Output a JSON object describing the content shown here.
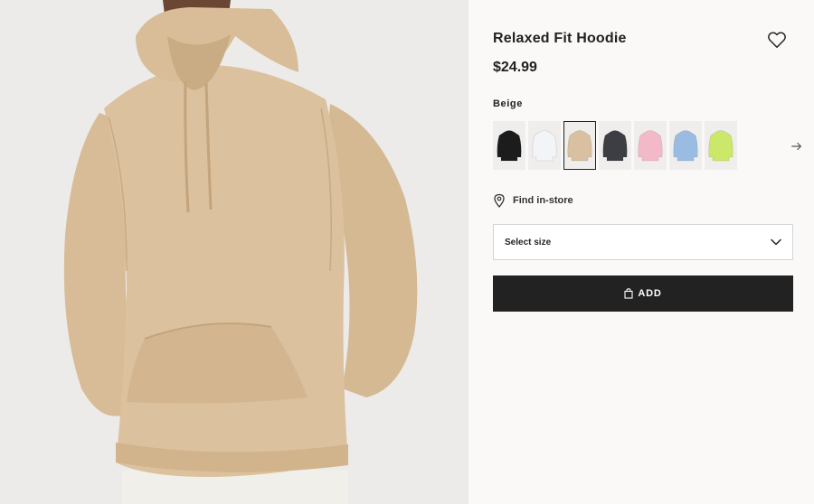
{
  "product": {
    "title": "Relaxed Fit Hoodie",
    "price": "$24.99",
    "selected_color": "Beige"
  },
  "swatches": [
    {
      "color": "#1c1c1c",
      "name": "black"
    },
    {
      "color": "#f2f4f7",
      "name": "white"
    },
    {
      "color": "#d9c0a0",
      "name": "beige"
    },
    {
      "color": "#3c3e44",
      "name": "dark-grey"
    },
    {
      "color": "#f3b9c8",
      "name": "pink"
    },
    {
      "color": "#9bbce2",
      "name": "light-blue"
    },
    {
      "color": "#cbe86a",
      "name": "lime"
    }
  ],
  "selected_swatch_index": 2,
  "store": {
    "find_label": "Find in-store"
  },
  "size": {
    "placeholder": "Select size"
  },
  "cart": {
    "add_label": "ADD"
  },
  "icons": {
    "favorite": "heart-icon",
    "next": "arrow-right-icon",
    "store": "location-pin-icon",
    "dropdown": "chevron-down-icon",
    "cart": "shopping-bag-icon"
  },
  "colors": {
    "accent_button": "#222222",
    "page_background": "#faf9f8",
    "image_background": "#ecebe9",
    "hoodie": "#dcc19e"
  }
}
